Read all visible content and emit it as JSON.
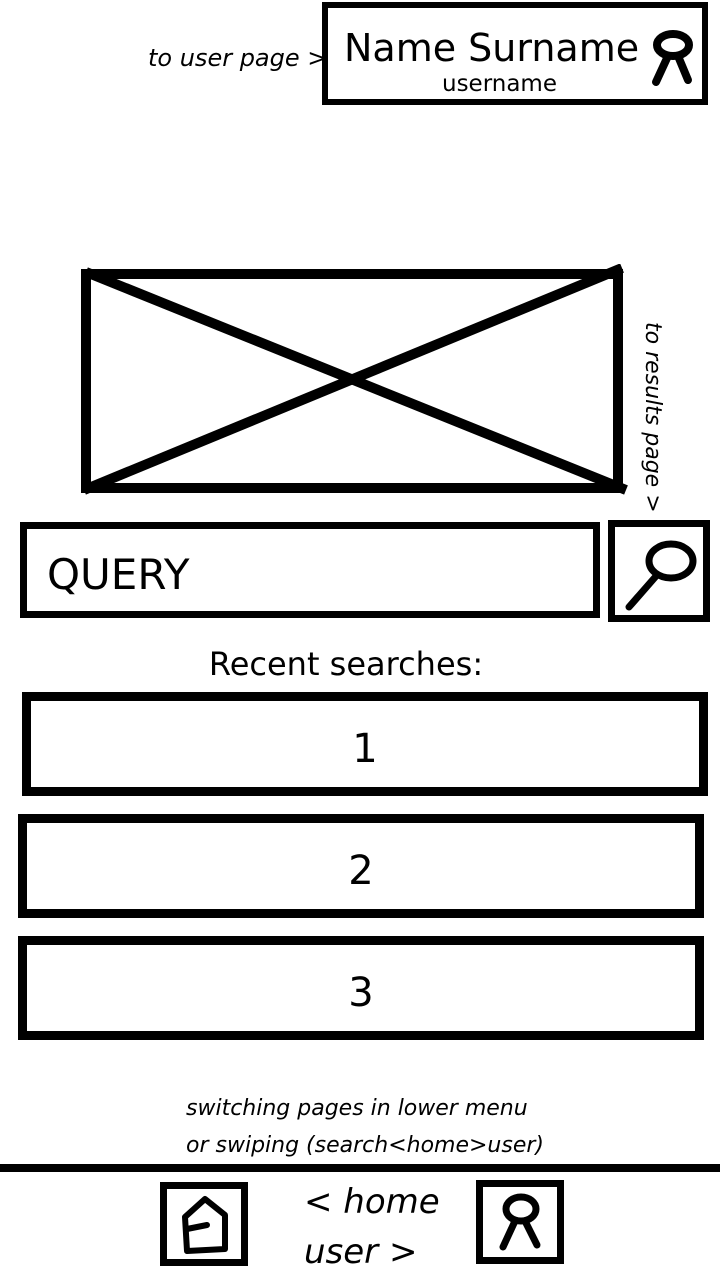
{
  "annotations": {
    "to_user_page": "to user page >",
    "to_results_page": "to results page >",
    "switching_line1": "switching pages in lower menu",
    "switching_line2": "or swiping (search<home>user)"
  },
  "profile": {
    "name": "Name Surname",
    "username": "username",
    "avatar_icon": "user-icon"
  },
  "image_placeholder": {
    "icon": "image-placeholder-icon"
  },
  "search": {
    "query": "QUERY",
    "button_icon": "search-icon"
  },
  "recent": {
    "title": "Recent searches:",
    "items": [
      "1",
      "2",
      "3"
    ]
  },
  "bottom_nav": {
    "home_label": "< home",
    "user_label": "user >",
    "home_icon": "home-icon",
    "user_icon": "user-icon"
  }
}
